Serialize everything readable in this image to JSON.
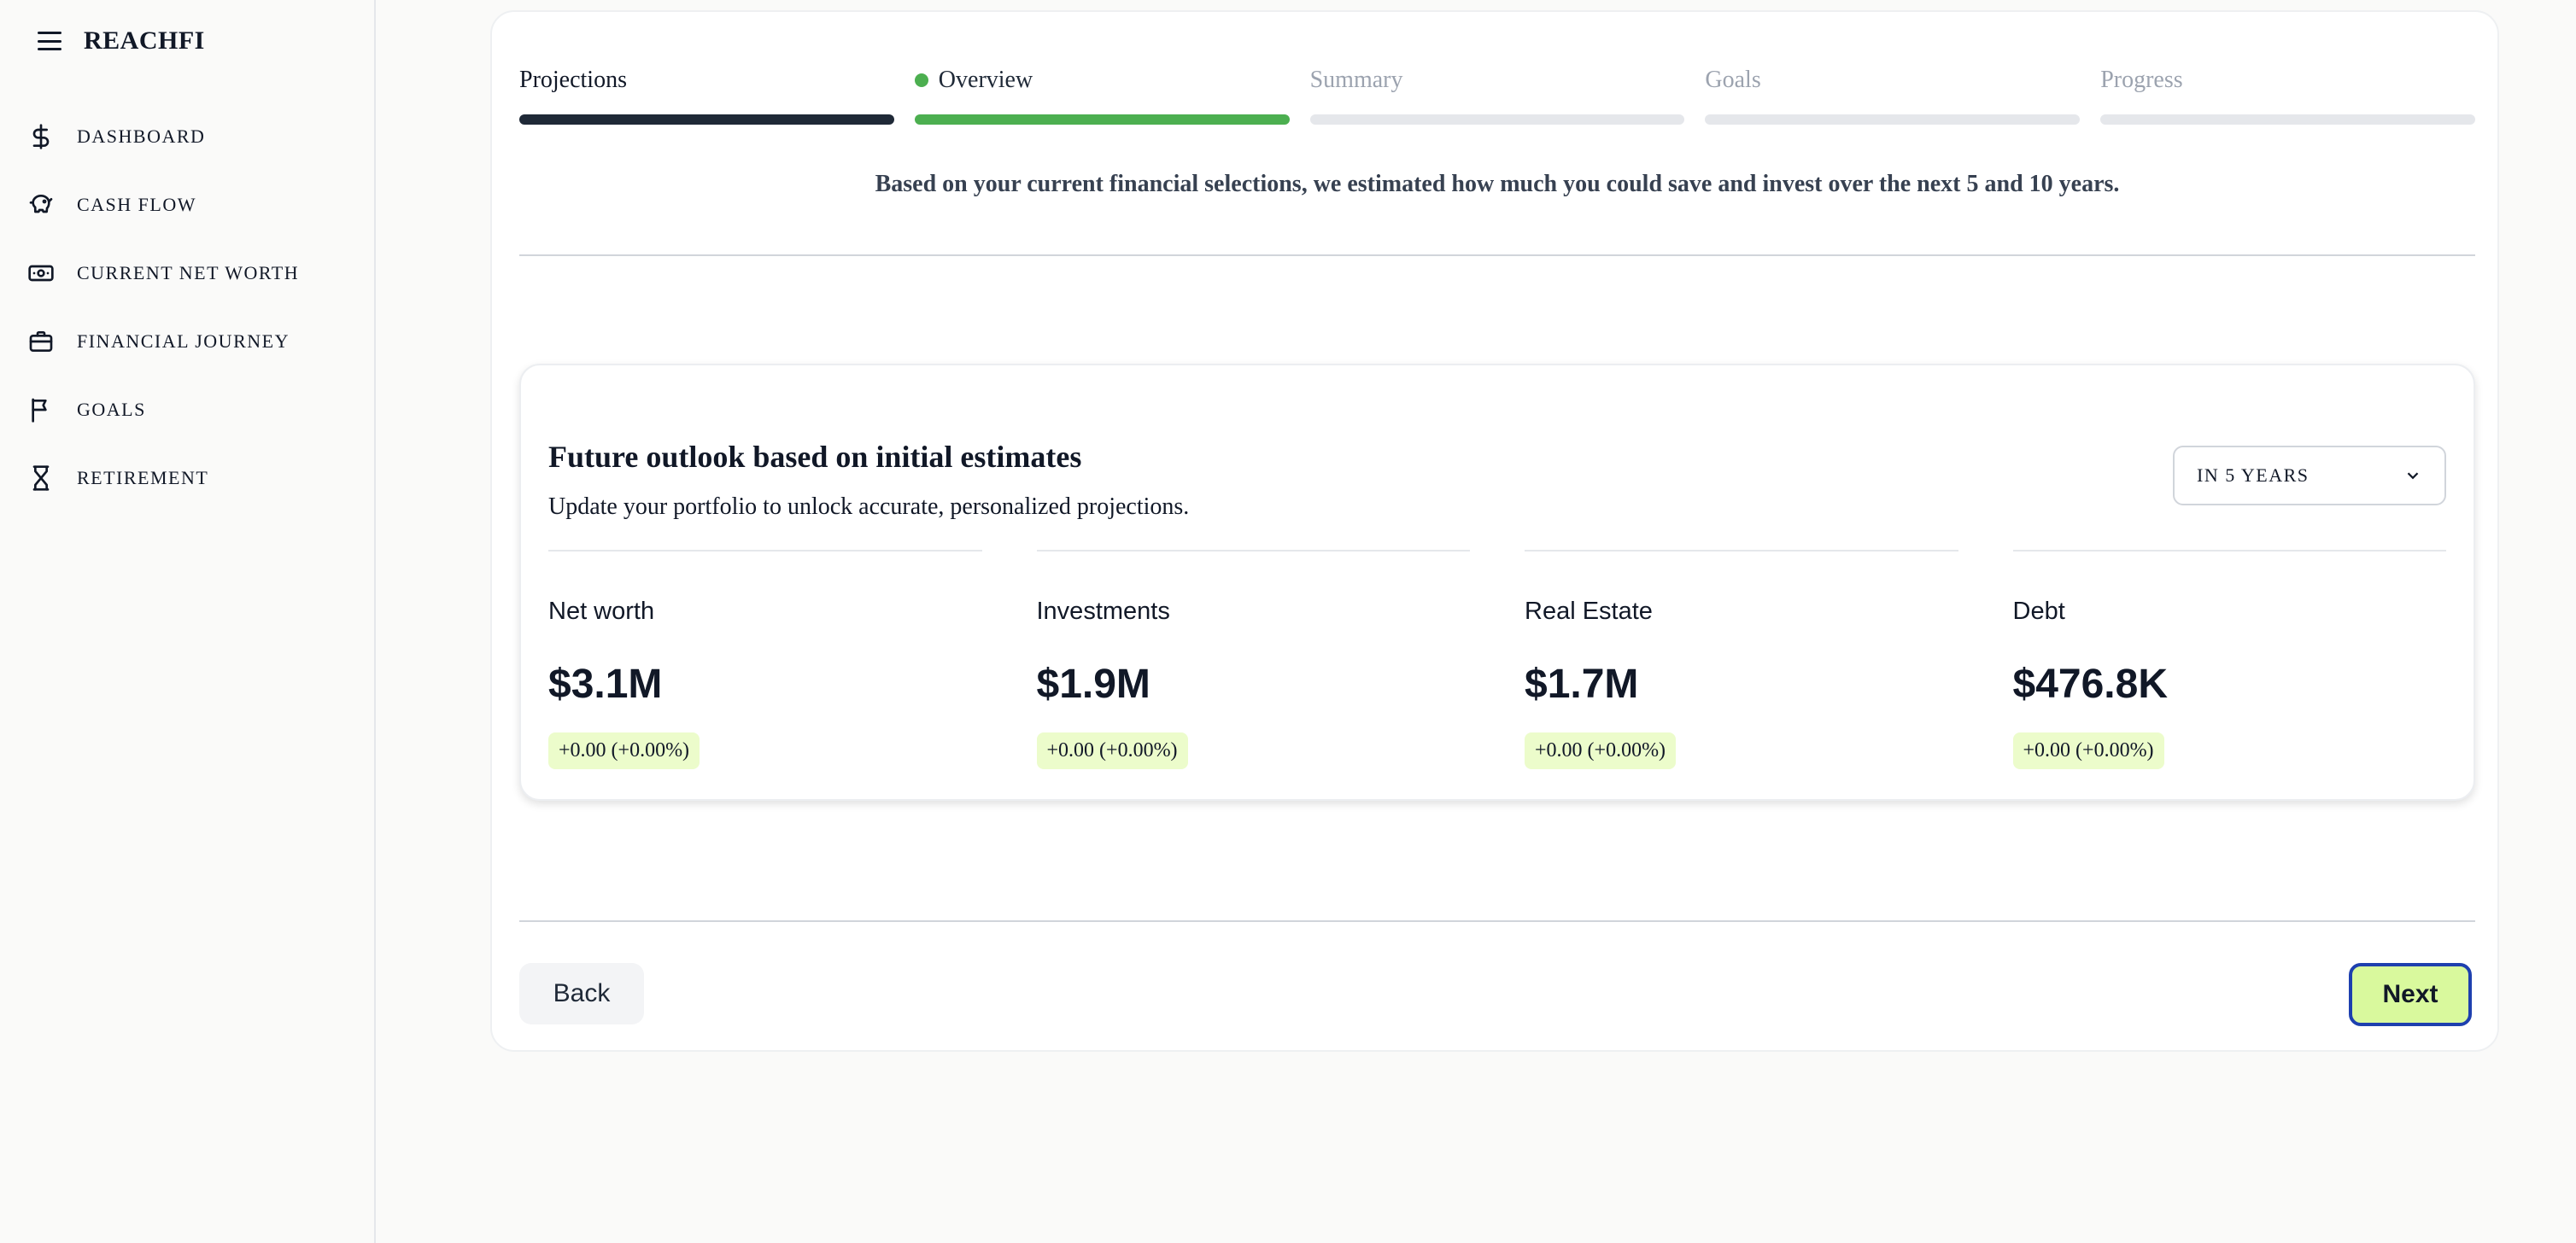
{
  "sidebar": {
    "brand": "REACHFI",
    "items": [
      {
        "label": "DASHBOARD",
        "icon": "dollar-icon"
      },
      {
        "label": "CASH FLOW",
        "icon": "piggy-bank-icon"
      },
      {
        "label": "CURRENT NET WORTH",
        "icon": "banknote-icon"
      },
      {
        "label": "FINANCIAL JOURNEY",
        "icon": "briefcase-icon"
      },
      {
        "label": "GOALS",
        "icon": "flag-icon"
      },
      {
        "label": "RETIREMENT",
        "icon": "hourglass-icon"
      }
    ]
  },
  "stepper": {
    "steps": [
      {
        "label": "Projections",
        "state": "done"
      },
      {
        "label": "Overview",
        "state": "active"
      },
      {
        "label": "Summary",
        "state": "todo"
      },
      {
        "label": "Goals",
        "state": "todo"
      },
      {
        "label": "Progress",
        "state": "todo"
      }
    ]
  },
  "intro": "Based on your current financial selections, we estimated how much you could save and invest over the next 5 and 10 years.",
  "outlook": {
    "title": "Future outlook based on initial estimates",
    "subtitle": "Update your portfolio to unlock accurate, personalized projections.",
    "period_select": "IN 5 YEARS",
    "metrics": [
      {
        "label": "Net worth",
        "value": "$3.1M",
        "change": "+0.00 (+0.00%)"
      },
      {
        "label": "Investments",
        "value": "$1.9M",
        "change": "+0.00 (+0.00%)"
      },
      {
        "label": "Real Estate",
        "value": "$1.7M",
        "change": "+0.00 (+0.00%)"
      },
      {
        "label": "Debt",
        "value": "$476.8K",
        "change": "+0.00 (+0.00%)"
      }
    ]
  },
  "actions": {
    "back": "Back",
    "next": "Next"
  },
  "colors": {
    "accent_green": "#4caf50",
    "next_button": "#d9f99d",
    "change_badge": "#ecfccb",
    "focus_ring": "#1e40af"
  }
}
